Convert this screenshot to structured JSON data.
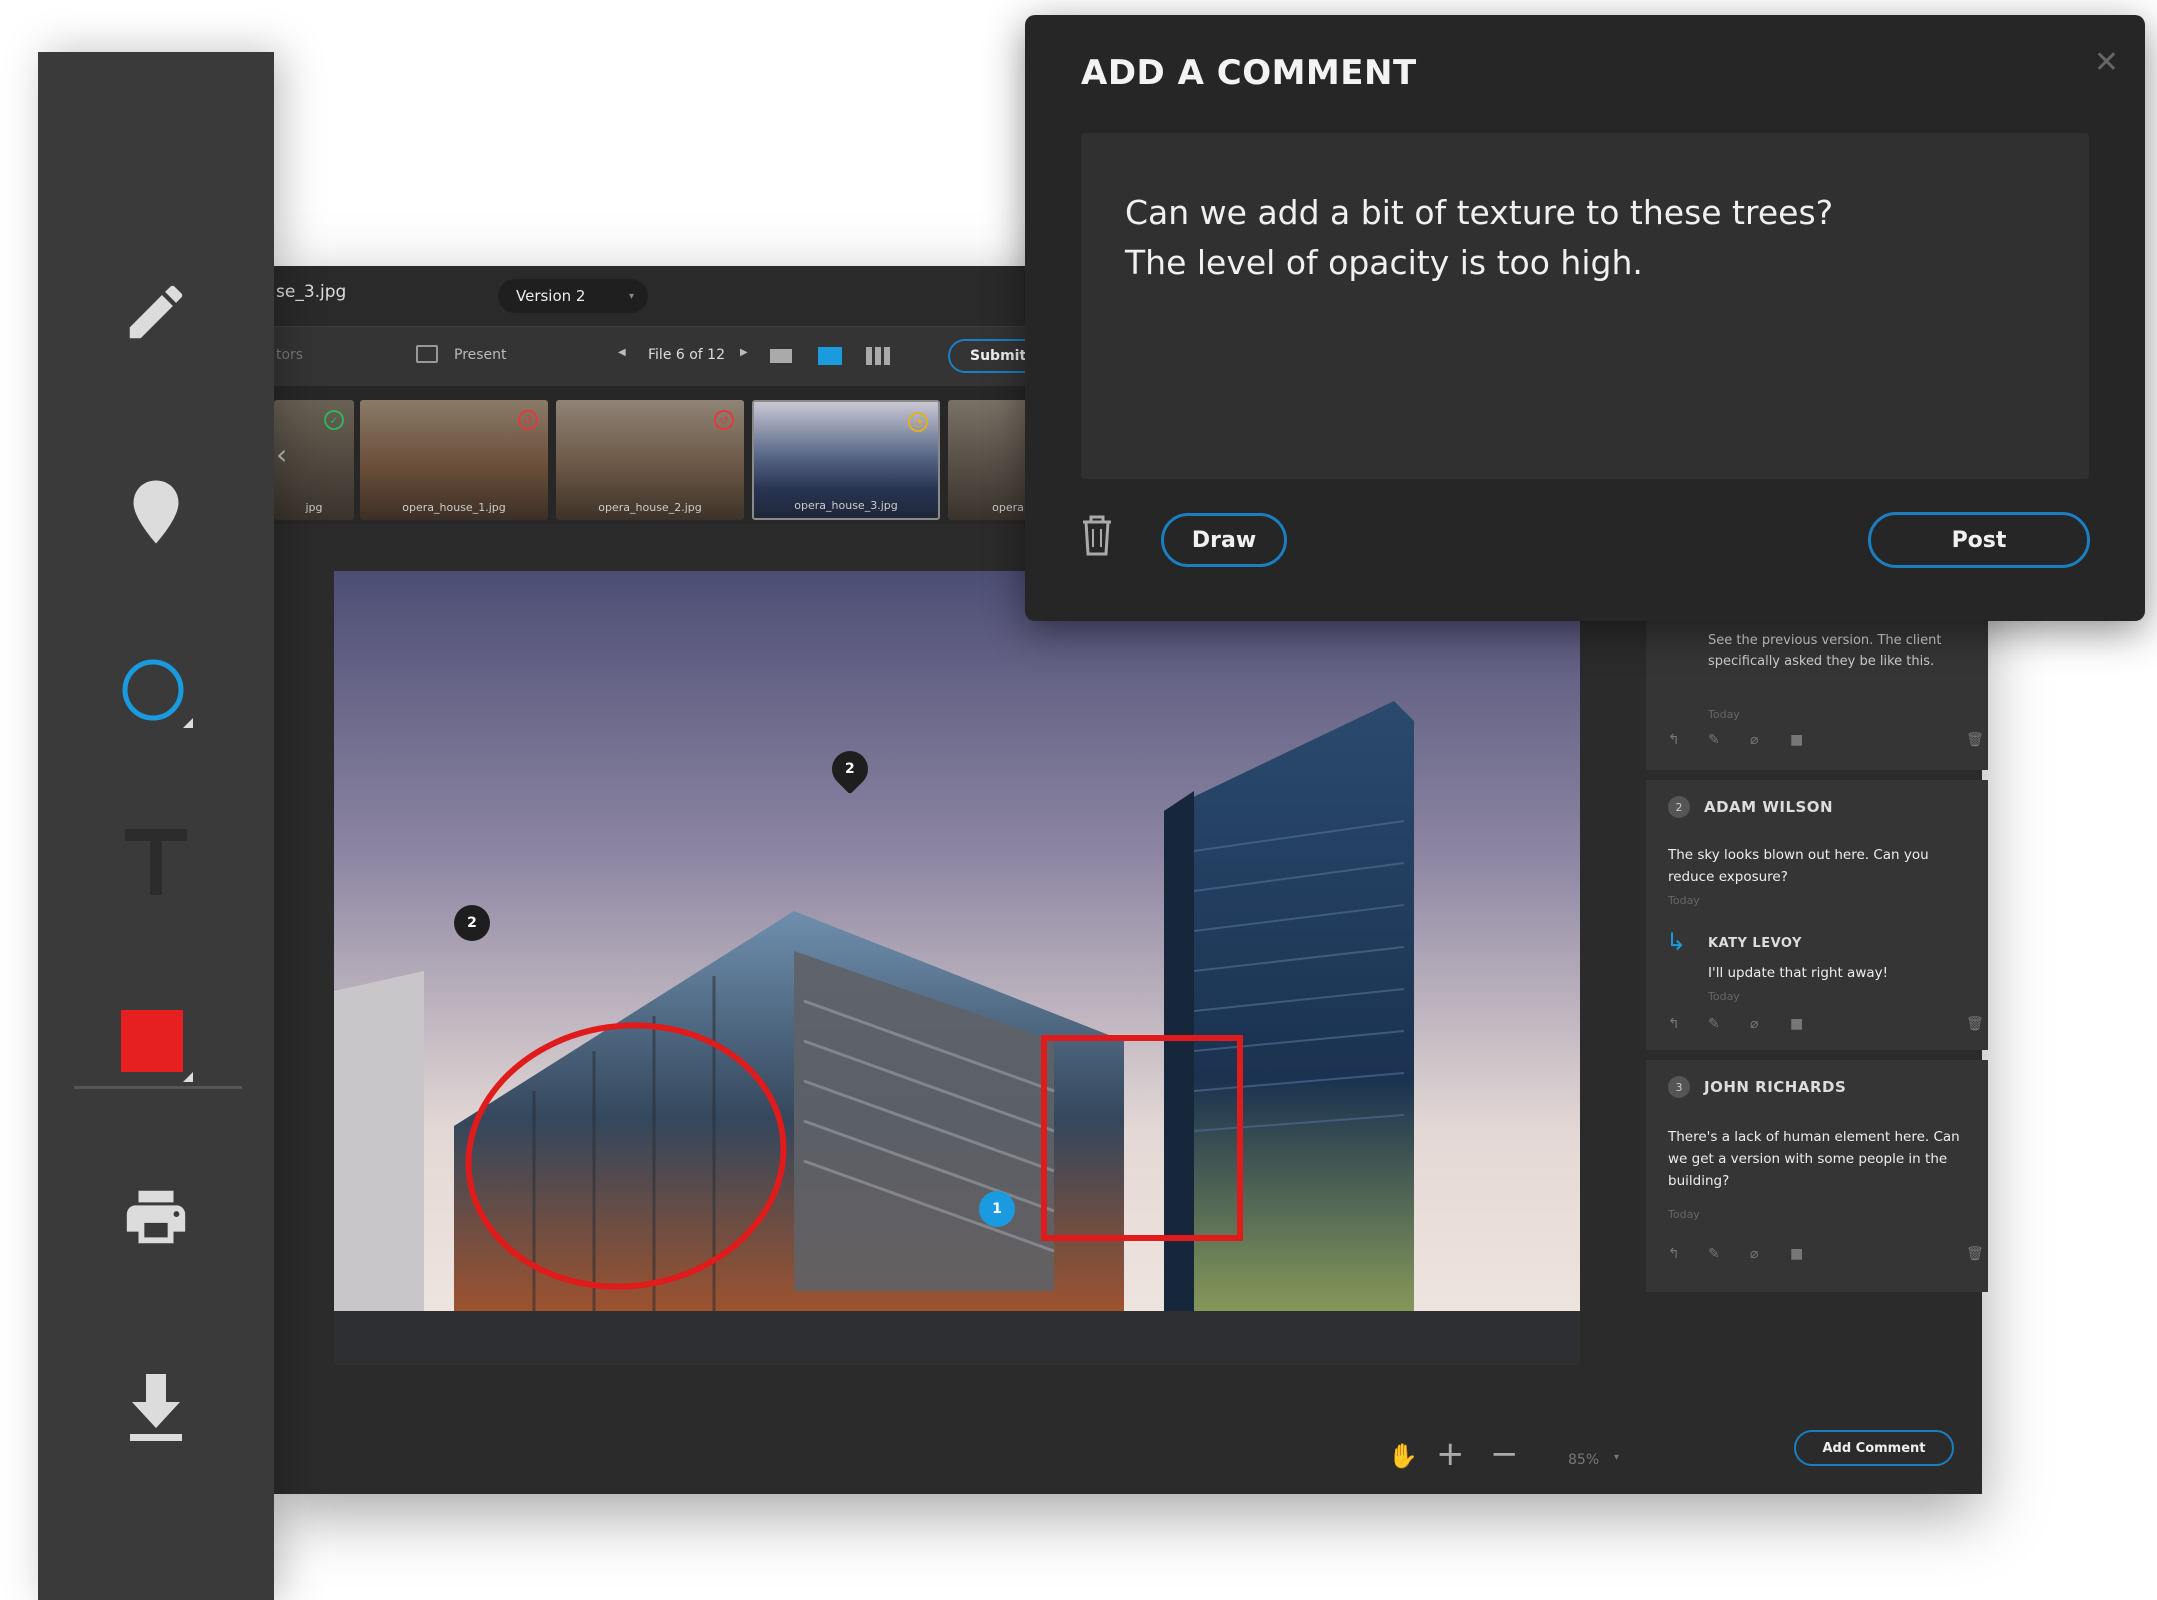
{
  "toolbar": {
    "tools": [
      "pencil-icon",
      "map-pin-icon",
      "circle-icon",
      "text-icon",
      "color-swatch",
      "print-icon",
      "download-icon"
    ],
    "active_color": "#e62020",
    "accent": "#1a9be0"
  },
  "app": {
    "filename": "se_3.jpg",
    "version_label": "Version 2",
    "nav": {
      "left_label": "tors",
      "present_label": "Present",
      "file_counter": "File 6 of 12",
      "submit_label": "Submit"
    },
    "thumbnails": [
      {
        "caption": "jpg",
        "status": "approved"
      },
      {
        "caption": "opera_house_1.jpg",
        "status": "rejected"
      },
      {
        "caption": "opera_house_2.jpg",
        "status": "rejected"
      },
      {
        "caption": "opera_house_3.jpg",
        "status": "pending"
      },
      {
        "caption": "opera",
        "status": "none"
      }
    ],
    "pins": [
      "2",
      "2",
      "1"
    ],
    "zoom": "85%"
  },
  "sidebar": {
    "first_card": {
      "body": "See the previous version. The client specifically asked they be like this.",
      "time": "Today"
    },
    "cards": [
      {
        "num": "2",
        "author": "ADAM WILSON",
        "body": "The sky looks blown out here. Can you reduce exposure?",
        "time": "Today",
        "reply": {
          "author": "KATY LEVOY",
          "body": "I'll update that right away!",
          "time": "Today"
        }
      },
      {
        "num": "3",
        "author": "JOHN RICHARDS",
        "body": "There's a lack of human element here. Can we get a version with some people in the building?",
        "time": "Today"
      }
    ],
    "add_comment_label": "Add Comment"
  },
  "popup": {
    "title": "ADD A COMMENT",
    "text_line1": "Can we add a bit of texture to these trees?",
    "text_line2": "The level of opacity is too high.",
    "draw_label": "Draw",
    "post_label": "Post"
  }
}
